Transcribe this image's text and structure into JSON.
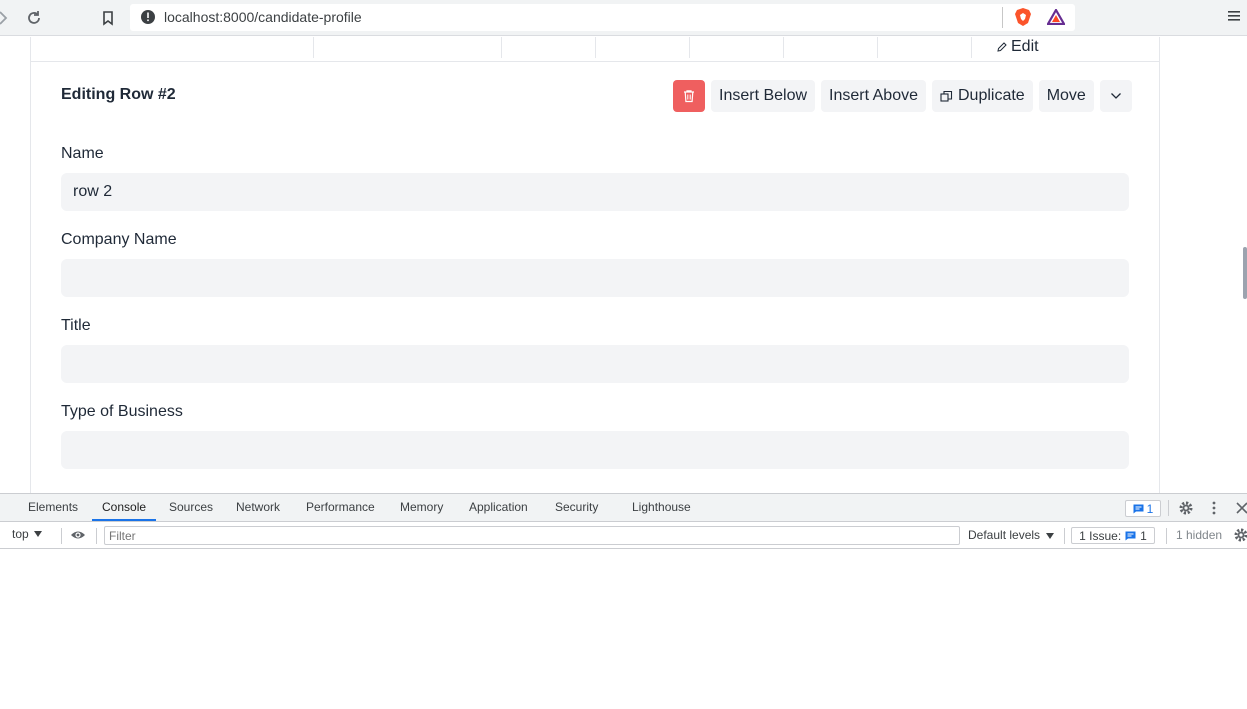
{
  "browser": {
    "url": "localhost:8000/candidate-profile"
  },
  "table": {
    "edit_label": "Edit"
  },
  "editor": {
    "title": "Editing Row #2",
    "buttons": {
      "insert_below": "Insert Below",
      "insert_above": "Insert Above",
      "duplicate": "Duplicate",
      "move": "Move"
    },
    "fields": [
      {
        "label": "Name",
        "value": "row 2"
      },
      {
        "label": "Company Name",
        "value": ""
      },
      {
        "label": "Title",
        "value": ""
      },
      {
        "label": "Type of Business",
        "value": ""
      }
    ]
  },
  "devtools": {
    "tabs": [
      "Elements",
      "Console",
      "Sources",
      "Network",
      "Performance",
      "Memory",
      "Application",
      "Security",
      "Lighthouse"
    ],
    "active_tab": "Console",
    "message_count": "1",
    "context": "top",
    "filter_placeholder": "Filter",
    "levels": "Default levels",
    "issues_label": "1 Issue:",
    "issues_count": "1",
    "hidden": "1 hidden"
  },
  "colors": {
    "delete_button": "#ef5f5f",
    "input_bg": "#f3f4f6",
    "devtools_accent": "#1a73e8"
  }
}
